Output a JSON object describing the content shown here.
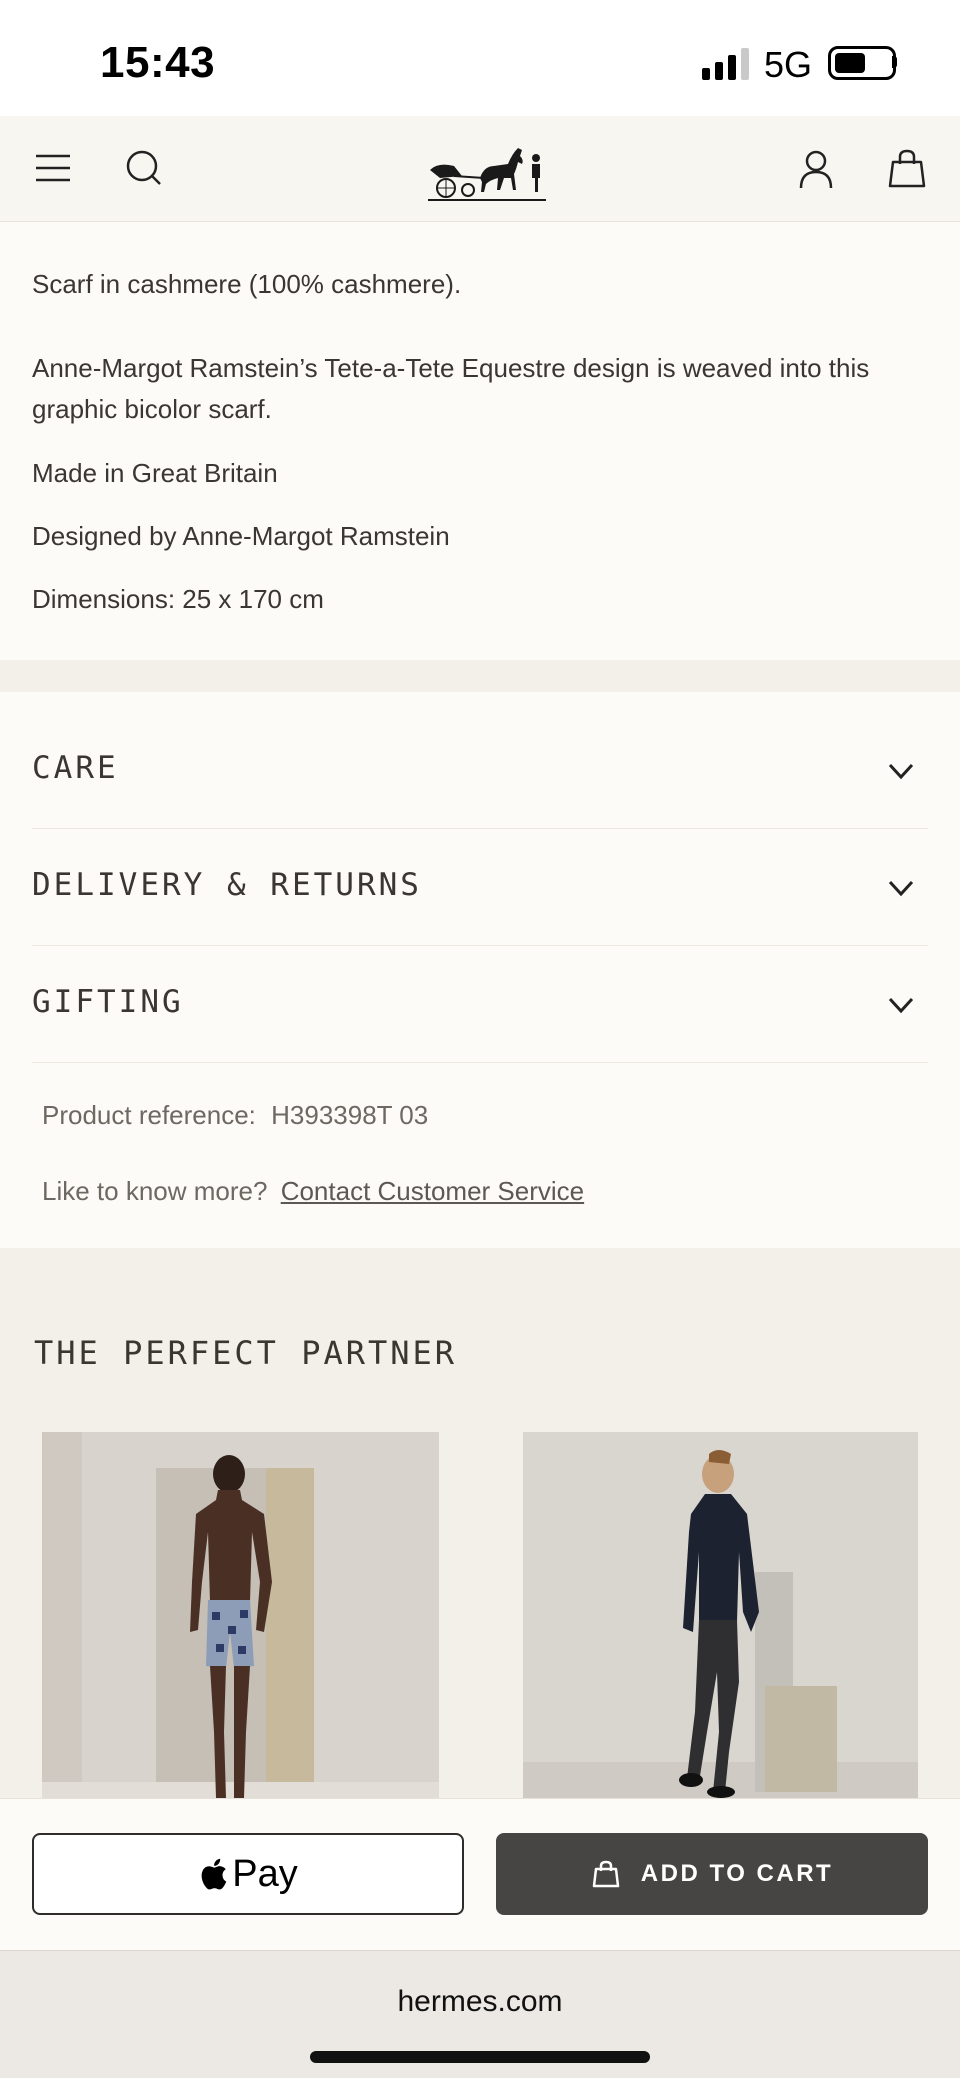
{
  "status_bar": {
    "time": "15:43",
    "network": "5G"
  },
  "header": {
    "brand": "Hermès"
  },
  "description": {
    "composition": "Scarf in cashmere (100% cashmere).",
    "body": "Anne-Margot Ramstein’s Tete-a-Tete Equestre design is weaved into this graphic bicolor scarf.",
    "origin": "Made in Great Britain",
    "designer": "Designed by Anne-Margot Ramstein",
    "dimensions": "Dimensions: 25 x 170 cm"
  },
  "accordions": [
    {
      "label": "CARE"
    },
    {
      "label": "DELIVERY & RETURNS"
    },
    {
      "label": "GIFTING"
    }
  ],
  "product_reference": {
    "label": "Product reference:",
    "value": "H393398T 03"
  },
  "contact": {
    "prompt": "Like to know more?",
    "link_text": "Contact Customer Service"
  },
  "partner": {
    "title": "THE PERFECT PARTNER"
  },
  "actions": {
    "apple_pay_label": "Pay",
    "add_to_cart_label": "ADD TO CART"
  },
  "browser": {
    "url": "hermes.com"
  }
}
